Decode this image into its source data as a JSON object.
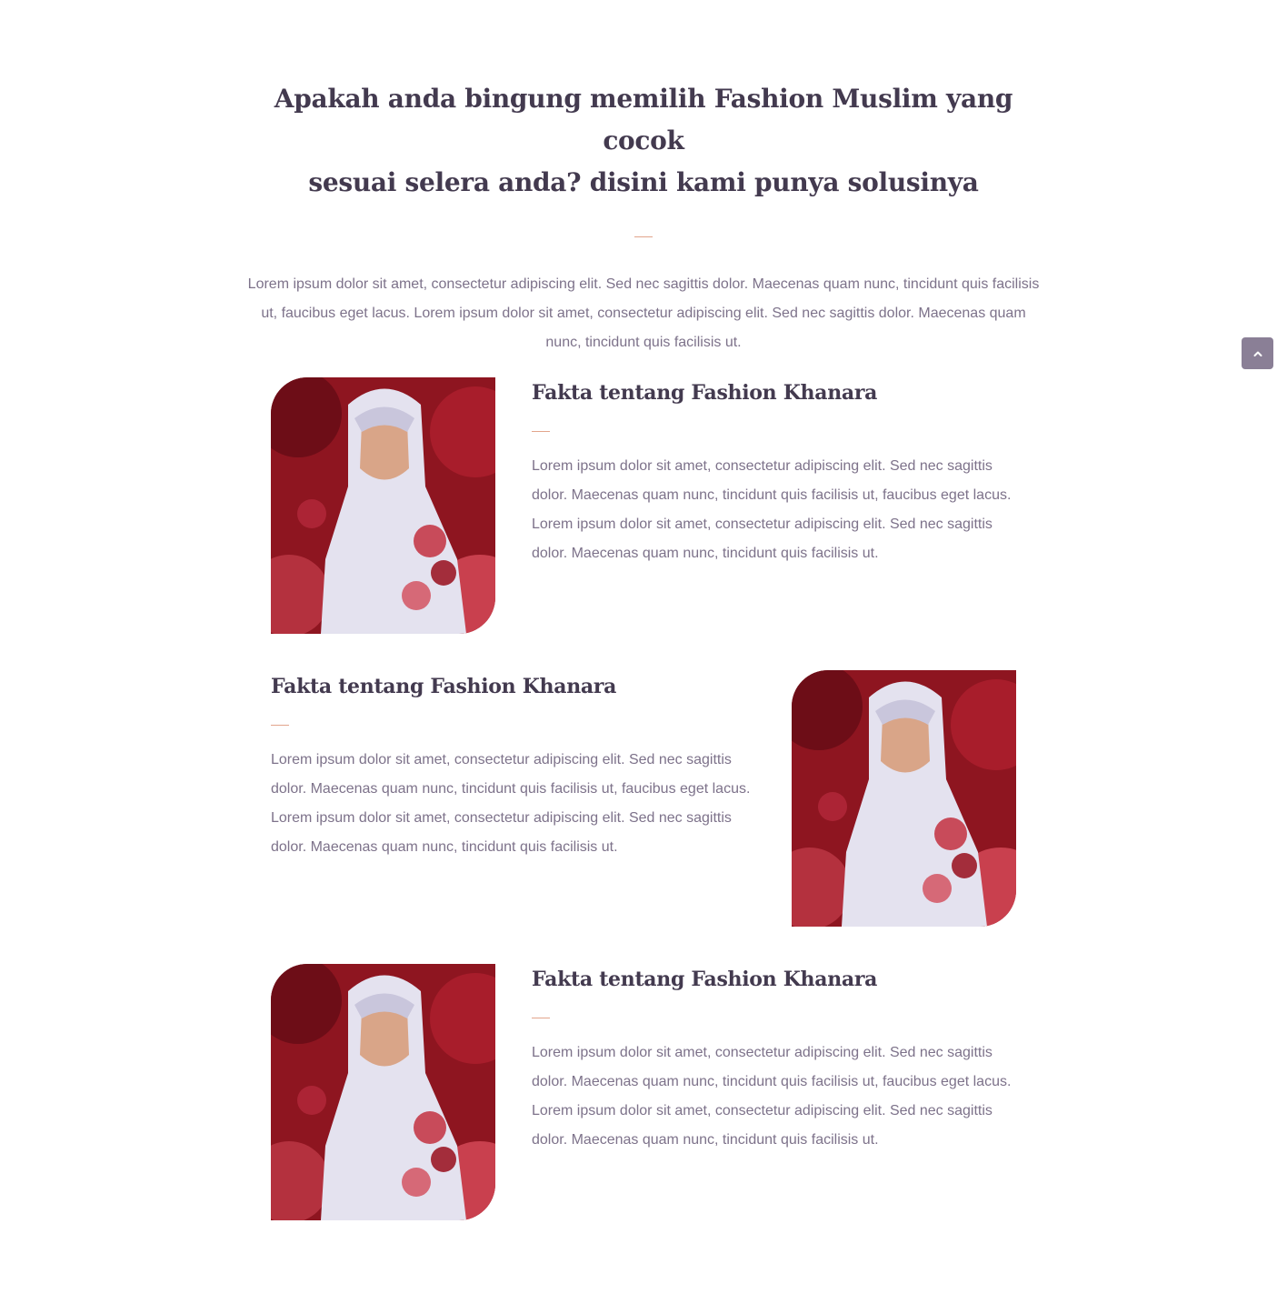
{
  "intro": {
    "title_line1": "Apakah anda bingung memilih Fashion Muslim yang cocok",
    "title_line2": "sesuai selera anda? disini kami punya solusinya",
    "text": "Lorem ipsum dolor sit amet, consectetur adipiscing elit. Sed nec sagittis dolor. Maecenas quam nunc, tincidunt quis facilisis ut, faucibus eget lacus. Lorem ipsum dolor sit amet, consectetur adipiscing elit. Sed nec sagittis dolor. Maecenas quam nunc, tincidunt quis facilisis ut."
  },
  "features": [
    {
      "title": "Fakta tentang Fashion Khanara",
      "text": "Lorem ipsum dolor sit amet, consectetur adipiscing elit. Sed nec sagittis dolor. Maecenas quam nunc, tincidunt quis facilisis ut, faucibus eget lacus. Lorem ipsum dolor sit amet, consectetur adipiscing elit. Sed nec sagittis dolor. Maecenas quam nunc, tincidunt quis facilisis ut."
    },
    {
      "title": "Fakta tentang Fashion Khanara",
      "text": "Lorem ipsum dolor sit amet, consectetur adipiscing elit. Sed nec sagittis dolor. Maecenas quam nunc, tincidunt quis facilisis ut, faucibus eget lacus. Lorem ipsum dolor sit amet, consectetur adipiscing elit. Sed nec sagittis dolor. Maecenas quam nunc, tincidunt quis facilisis ut."
    },
    {
      "title": "Fakta tentang Fashion Khanara",
      "text": "Lorem ipsum dolor sit amet, consectetur adipiscing elit. Sed nec sagittis dolor. Maecenas quam nunc, tincidunt quis facilisis ut, faucibus eget lacus. Lorem ipsum dolor sit amet, consectetur adipiscing elit. Sed nec sagittis dolor. Maecenas quam nunc, tincidunt quis facilisis ut."
    }
  ],
  "scroll_top": {
    "icon": "chevron-up-icon"
  },
  "colors": {
    "heading": "#433a4f",
    "body_text": "#7d728a",
    "accent_divider": "#e2a58c",
    "scroll_button": "#8a7f96"
  }
}
